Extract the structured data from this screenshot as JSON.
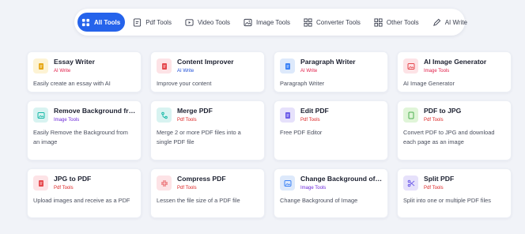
{
  "nav": [
    {
      "label": "All Tools",
      "icon": "grid-icon",
      "active": true
    },
    {
      "label": "Pdf Tools",
      "icon": "pdf-icon"
    },
    {
      "label": "Video Tools",
      "icon": "video-icon"
    },
    {
      "label": "Image Tools",
      "icon": "image-icon"
    },
    {
      "label": "Converter Tools",
      "icon": "converter-grid-icon"
    },
    {
      "label": "Other Tools",
      "icon": "other-grid-icon"
    },
    {
      "label": "AI Write",
      "icon": "pen-icon"
    }
  ],
  "colors": {
    "accent": "#2563eb",
    "ai_write": "#e11d48",
    "image_tools": "#6d28d9",
    "pdf_tools": "#dc2626"
  },
  "cards": [
    {
      "title": "Essay Writer",
      "category": "AI Write",
      "desc": "Easily create an essay with AI",
      "icon": "document-icon",
      "icon_bg": "#fdf3d4",
      "icon_fg": "#e6a817",
      "cat_color": "#e11d48"
    },
    {
      "title": "Content Improver",
      "category": "AI Write",
      "desc": "Improve your content",
      "icon": "document-icon",
      "icon_bg": "#fde3e6",
      "icon_fg": "#e5484d",
      "cat_color": "#1d4ed8"
    },
    {
      "title": "Paragraph Writer",
      "category": "AI Write",
      "desc": "Paragraph Writer",
      "icon": "document-icon",
      "icon_bg": "#dde9fb",
      "icon_fg": "#3b82f6",
      "cat_color": "#e11d48"
    },
    {
      "title": "AI Image Generator",
      "category": "Image Tools",
      "desc": "AI Image Generator",
      "icon": "image-icon",
      "icon_bg": "#fde3e6",
      "icon_fg": "#e5484d",
      "cat_color": "#e11d48"
    },
    {
      "title": "Remove Background from Image",
      "category": "Image Tools",
      "desc": "Easily Remove the Background from an image",
      "icon": "image-icon",
      "icon_bg": "#d8f3f1",
      "icon_fg": "#14b8a6",
      "cat_color": "#6d28d9"
    },
    {
      "title": "Merge PDF",
      "category": "Pdf Tools",
      "desc": "Merge 2 or more PDF files into a single PDF file",
      "icon": "merge-icon",
      "icon_bg": "#d8f3f1",
      "icon_fg": "#14b8a6",
      "cat_color": "#dc2626"
    },
    {
      "title": "Edit PDF",
      "category": "Pdf Tools",
      "desc": "Free PDF Editor",
      "icon": "document-icon",
      "icon_bg": "#e6e1fb",
      "icon_fg": "#6d5ce8",
      "cat_color": "#dc2626"
    },
    {
      "title": "PDF to JPG",
      "category": "Pdf Tools",
      "desc": "Convert PDF to JPG and download each page as an image",
      "icon": "document-icon",
      "icon_bg": "#e0f5d8",
      "icon_fg": "#4caf50",
      "cat_color": "#dc2626"
    },
    {
      "title": "JPG to PDF",
      "category": "Pdf Tools",
      "desc": "Upload images and receive as a PDF",
      "icon": "document-icon",
      "icon_bg": "#fde3e6",
      "icon_fg": "#e5484d",
      "cat_color": "#dc2626"
    },
    {
      "title": "Compress PDF",
      "category": "Pdf Tools",
      "desc": "Lessen the file size of a PDF file",
      "icon": "compress-icon",
      "icon_bg": "#fde3e6",
      "icon_fg": "#e5484d",
      "cat_color": "#dc2626"
    },
    {
      "title": "Change Background of Image",
      "category": "Image Tools",
      "desc": "Change Background of Image",
      "icon": "image-icon",
      "icon_bg": "#dde9fb",
      "icon_fg": "#3b82f6",
      "cat_color": "#6d28d9"
    },
    {
      "title": "Split PDF",
      "category": "Pdf Tools",
      "desc": "Split into one or multiple PDF files",
      "icon": "scissors-icon",
      "icon_bg": "#e6e1fb",
      "icon_fg": "#6d5ce8",
      "cat_color": "#dc2626"
    }
  ]
}
